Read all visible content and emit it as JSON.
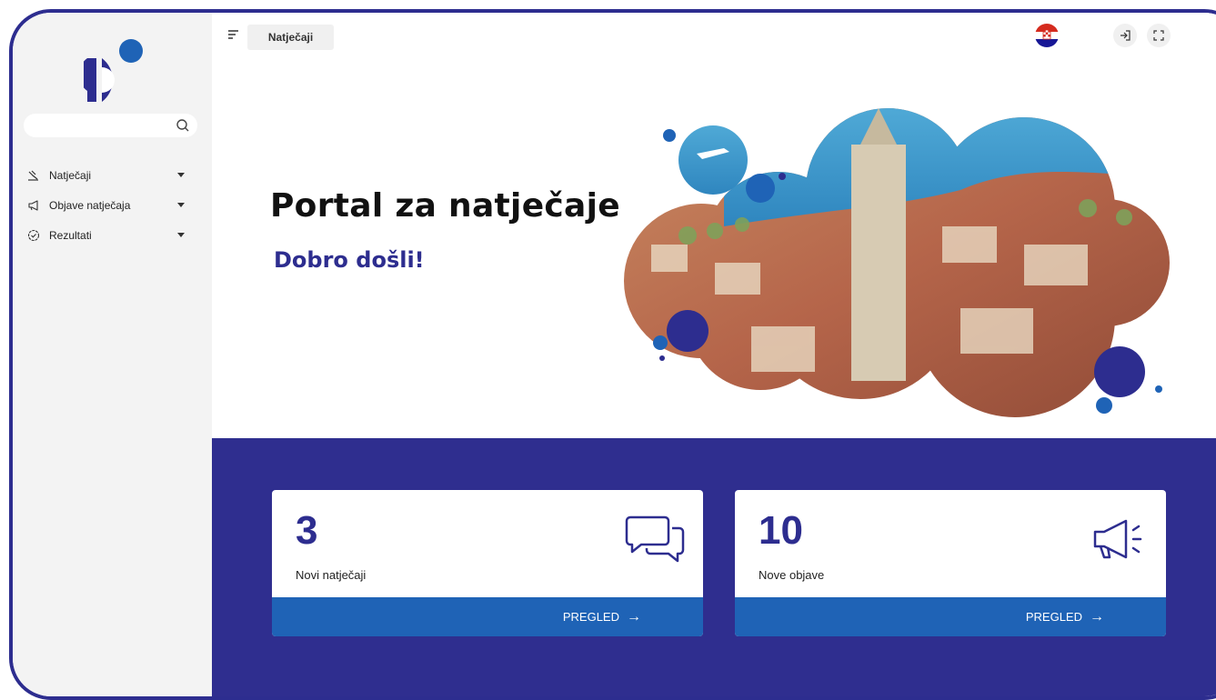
{
  "sidebar": {
    "search": {
      "placeholder": "",
      "value": ""
    },
    "items": [
      {
        "label": "Natječaji",
        "icon": "gavel-icon"
      },
      {
        "label": "Objave natječaja",
        "icon": "megaphone-icon"
      },
      {
        "label": "Rezultati",
        "icon": "check-circle-icon"
      }
    ]
  },
  "topbar": {
    "tab_label": "Natječaji",
    "language_flag": "croatia-flag",
    "actions": [
      "login-icon",
      "fullscreen-icon"
    ]
  },
  "hero": {
    "title": "Portal za natječaje",
    "subtitle": "Dobro došli!"
  },
  "cards": [
    {
      "count": "3",
      "caption": "Novi natječaji",
      "action": "PREGLED",
      "icon": "chat-icon"
    },
    {
      "count": "10",
      "caption": "Nove objave",
      "action": "PREGLED",
      "icon": "megaphone-icon"
    }
  ],
  "colors": {
    "brand": "#2d2d8f",
    "accent": "#1f63b6",
    "sidebar_bg": "#f3f3f3"
  }
}
